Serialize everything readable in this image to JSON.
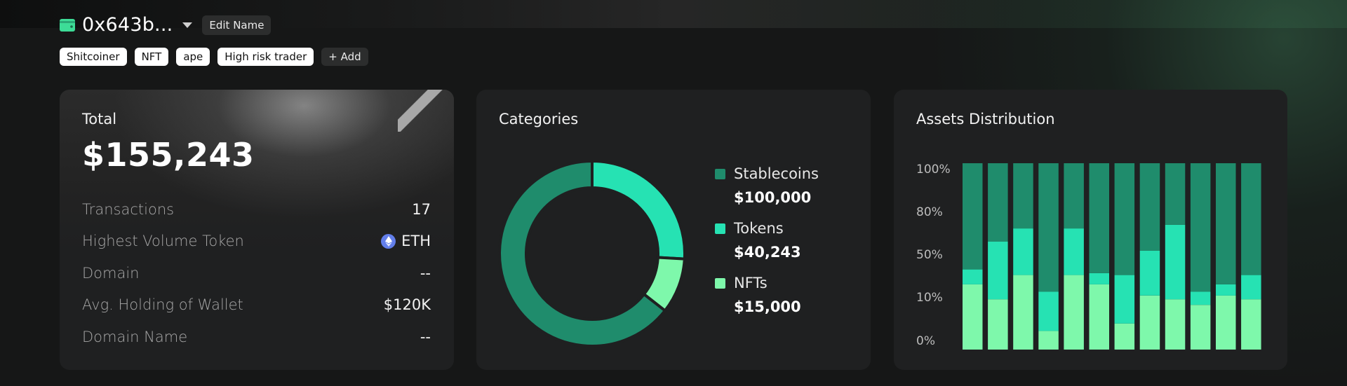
{
  "colors": {
    "dark": "#1f8c6c",
    "mid": "#26e2b3",
    "light": "#7ef8ab",
    "background": "#161717",
    "card": "#1f2021"
  },
  "header": {
    "wallet_icon": "wallet-icon",
    "address": "0x643b...",
    "edit_label": "Edit Name"
  },
  "tags": {
    "items": [
      "Shitcoiner",
      "NFT",
      "ape",
      "High risk trader"
    ],
    "add_label": "+ Add"
  },
  "total": {
    "title": "Total",
    "value": "$155,243",
    "rows": [
      {
        "label": "Transactions",
        "value": "17"
      },
      {
        "label": "Highest Volume Token",
        "value": "ETH",
        "icon": "ethereum-icon"
      },
      {
        "label": "Domain",
        "value": "--"
      },
      {
        "label": "Avg. Holding of Wallet",
        "value": "$120K"
      },
      {
        "label": "Domain Name",
        "value": "--"
      }
    ]
  },
  "categories": {
    "title": "Categories",
    "items": [
      {
        "name": "Stablecoins",
        "value_text": "$100,000",
        "value": 100000,
        "color": "#1f8c6c"
      },
      {
        "name": "Tokens",
        "value_text": "$40,243",
        "value": 40243,
        "color": "#26e2b3"
      },
      {
        "name": "NFTs",
        "value_text": "$15,000",
        "value": 15000,
        "color": "#7ef8ab"
      }
    ]
  },
  "chart_data": {
    "type": "bar",
    "title": "Assets Distribution",
    "stacked": true,
    "y_tick_labels": [
      "100%",
      "80%",
      "50%",
      "10%",
      "0%"
    ],
    "ylim": [
      0,
      100
    ],
    "series": [
      {
        "color": "#7ef8ab",
        "values": [
          35,
          27,
          40,
          10,
          40,
          35,
          14,
          29,
          27,
          24,
          29,
          27
        ]
      },
      {
        "color": "#26e2b3",
        "values": [
          8,
          31,
          25,
          21,
          25,
          6,
          26,
          24,
          40,
          7,
          6,
          13
        ]
      },
      {
        "color": "#1f8c6c",
        "values": [
          57,
          42,
          35,
          69,
          35,
          59,
          60,
          47,
          33,
          69,
          65,
          60
        ]
      }
    ]
  }
}
